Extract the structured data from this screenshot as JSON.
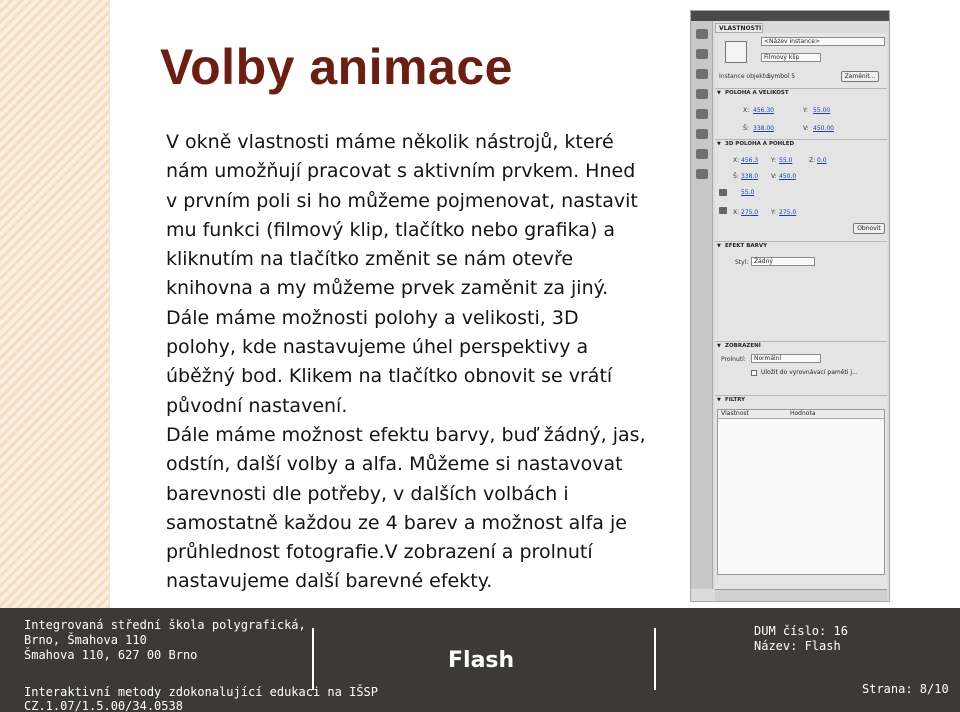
{
  "slide": {
    "title": "Volby animace",
    "paragraphs": [
      "V okně vlastnosti máme několik nástrojů, které",
      "nám umožňují pracovat s aktivním prvkem. Hned",
      "v prvním poli si ho můžeme pojmenovat, nastavit",
      "mu funkci (filmový klip, tlačítko nebo grafika) a",
      "kliknutím na tlačítko změnit se nám otevře",
      "knihovna a my můžeme prvek zaměnit za jiný.",
      "Dále máme možnosti polohy a velikosti, 3D",
      "polohy, kde nastavujeme úhel perspektivy a",
      "úběžný bod. Klikem na tlačítko obnovit se vrátí",
      "původní nastavení.",
      "Dále máme možnost efektu barvy, buď žádný, jas,",
      "odstín, další volby a alfa. Můžeme si nastavovat",
      "barevnosti dle potřeby, v dalších volbách i",
      "samostatně každou ze 4 barev a možnost alfa je",
      "průhlednost fotografie.V zobrazení a prolnutí",
      "nastavujeme další barevné efekty."
    ]
  },
  "panel": {
    "tab": "VLASTNOSTI",
    "instance_name_placeholder": "<Název instance>",
    "type_select": "Filmový klip",
    "instance_label": "Instance objektu:",
    "instance_value": "Symbol 5",
    "swap_button": "Zaměnit...",
    "section_position": "POLOHA A VELIKOST",
    "x_label": "X:",
    "x_value": "456.30",
    "y_label": "Y:",
    "y_value": "55.00",
    "w_label": "Š:",
    "w_value": "338.00",
    "h_label": "V:",
    "h_value": "450.00",
    "section_3d": "3D POLOHA A POHLED",
    "x3_label": "X:",
    "x3_value": "456.3",
    "y3_label": "Y:",
    "y3_value": "55.0",
    "z3_label": "Z:",
    "z3_value": "0.0",
    "w3_label": "Š:",
    "w3_value": "338.0",
    "h3_label": "V:",
    "h3_value": "450.0",
    "persp_value": "55.0",
    "vx_label": "X:",
    "vx_value": "275.0",
    "vy_label": "Y:",
    "vy_value": "275.0",
    "reset_button": "Obnovit",
    "section_color": "EFEKT BARVY",
    "style_label": "Styl:",
    "style_value": "Žádný",
    "section_display": "ZOBRAZENÍ",
    "blend_label": "Prolnutí:",
    "blend_value": "Normální",
    "cache_label": "Uložit do vyrovnávací paměti j...",
    "section_filters": "FILTRY",
    "col_property": "Vlastnost",
    "col_value": "Hodnota"
  },
  "footer": {
    "school_line1": "Integrovaná střední škola polygrafická,",
    "school_line2": "Brno, Šmahova 110",
    "school_line3": "Šmahova 110, 627 00 Brno",
    "project_line1": "Interaktivní metody zdokonalující edukaci na IŠSP",
    "project_line2": "CZ.1.07/1.5.00/34.0538",
    "subject": "Flash",
    "dum": "DUM číslo: 16",
    "name": "Název: Flash",
    "page": "Strana: 8/10"
  },
  "colors": {
    "title": "#6b1e14",
    "footer_bg": "#3c3a36",
    "link_value": "#1f3fb2"
  }
}
